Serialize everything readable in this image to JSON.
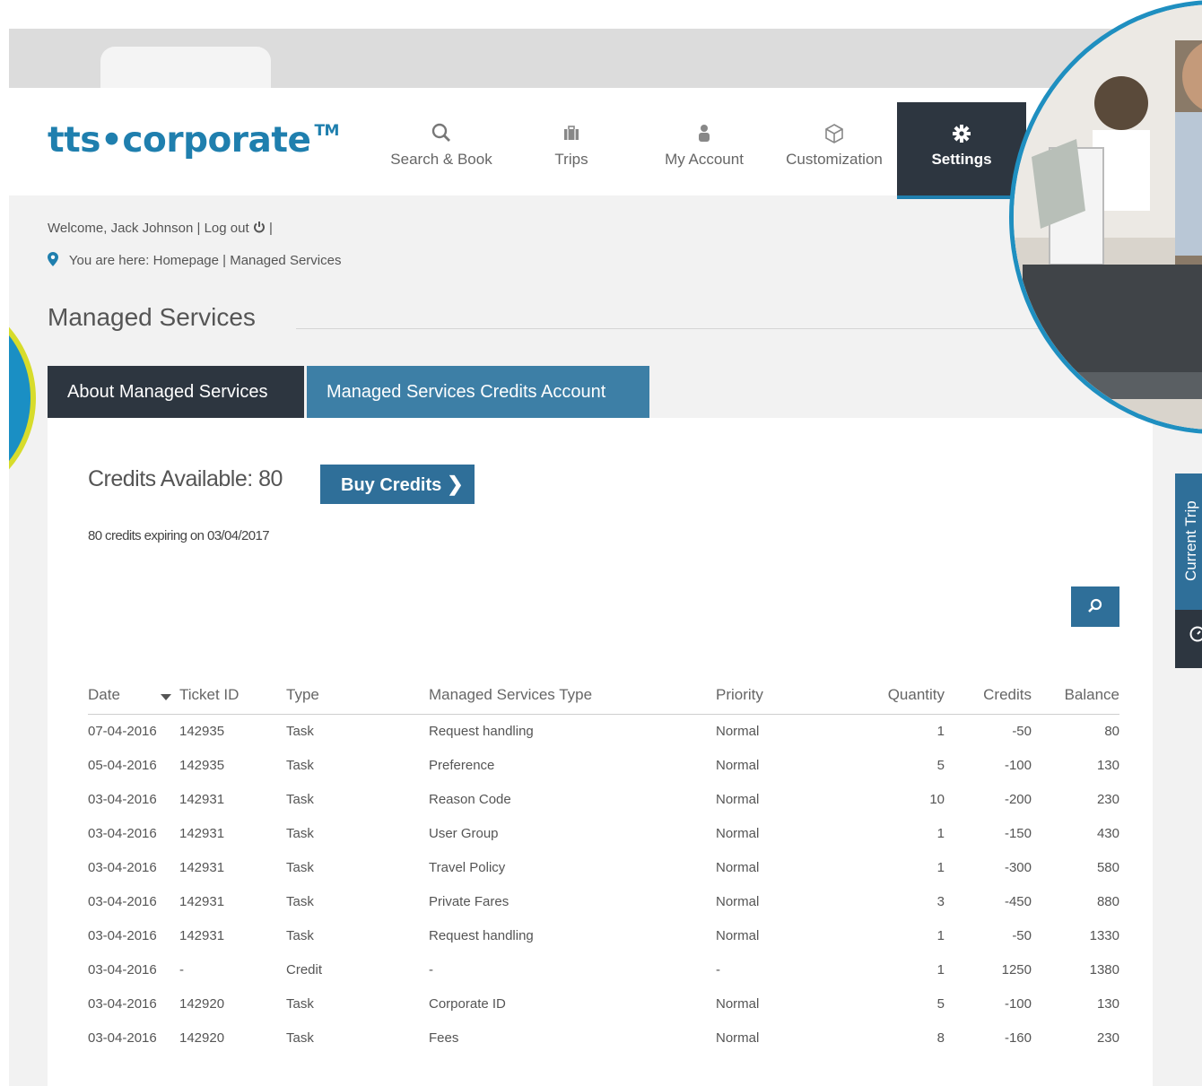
{
  "brand": {
    "name": "tts•corporate",
    "trademark": "TM",
    "color": "#1f7fae"
  },
  "nav": {
    "items": [
      {
        "label": "Search & Book",
        "icon": "search-icon"
      },
      {
        "label": "Trips",
        "icon": "briefcase-icon"
      },
      {
        "label": "My Account",
        "icon": "user-icon"
      },
      {
        "label": "Customization",
        "icon": "box-icon"
      },
      {
        "label": "Settings",
        "icon": "gear-icon",
        "active": true
      }
    ]
  },
  "user": {
    "welcome": "Welcome, Jack Johnson",
    "separator": "|",
    "logout": "Log out"
  },
  "breadcrumb": {
    "prefix": "You are here:",
    "path": "Homepage | Managed Services"
  },
  "page": {
    "title": "Managed Services"
  },
  "tabs": [
    {
      "label": "About Managed Services"
    },
    {
      "label": "Managed Services Credits Account",
      "active": true
    }
  ],
  "credits": {
    "available_label": "Credits Available: 80",
    "buy_button": "Buy Credits",
    "expiry_note": "80 credits expiring on 03/04/2017"
  },
  "table": {
    "headers": [
      "Date",
      "Ticket ID",
      "Type",
      "Managed Services Type",
      "Priority",
      "Quantity",
      "Credits",
      "Balance"
    ],
    "rows": [
      [
        "07-04-2016",
        "142935",
        "Task",
        "Request handling",
        "Normal",
        "1",
        "-50",
        "80"
      ],
      [
        "05-04-2016",
        "142935",
        "Task",
        "Preference",
        "Normal",
        "5",
        "-100",
        "130"
      ],
      [
        "03-04-2016",
        "142931",
        "Task",
        "Reason Code",
        "Normal",
        "10",
        "-200",
        "230"
      ],
      [
        "03-04-2016",
        "142931",
        "Task",
        "User Group",
        "Normal",
        "1",
        "-150",
        "430"
      ],
      [
        "03-04-2016",
        "142931",
        "Task",
        "Travel Policy",
        "Normal",
        "1",
        "-300",
        "580"
      ],
      [
        "03-04-2016",
        "142931",
        "Task",
        "Private Fares",
        "Normal",
        "3",
        "-450",
        "880"
      ],
      [
        "03-04-2016",
        "142931",
        "Task",
        "Request handling",
        "Normal",
        "1",
        "-50",
        "1330"
      ],
      [
        "03-04-2016",
        "-",
        "Credit",
        "-",
        "-",
        "1",
        "1250",
        "1380"
      ],
      [
        "03-04-2016",
        "142920",
        "Task",
        "Corporate ID",
        "Normal",
        "5",
        "-100",
        "130"
      ],
      [
        "03-04-2016",
        "142920",
        "Task",
        "Fees",
        "Normal",
        "8",
        "-160",
        "230"
      ]
    ]
  },
  "side_tab": {
    "label": "Current Trip",
    "icon": "clock-icon"
  },
  "colors": {
    "accent": "#2f6f99",
    "dark": "#2d3640",
    "tab_active": "#3d7fa6"
  }
}
